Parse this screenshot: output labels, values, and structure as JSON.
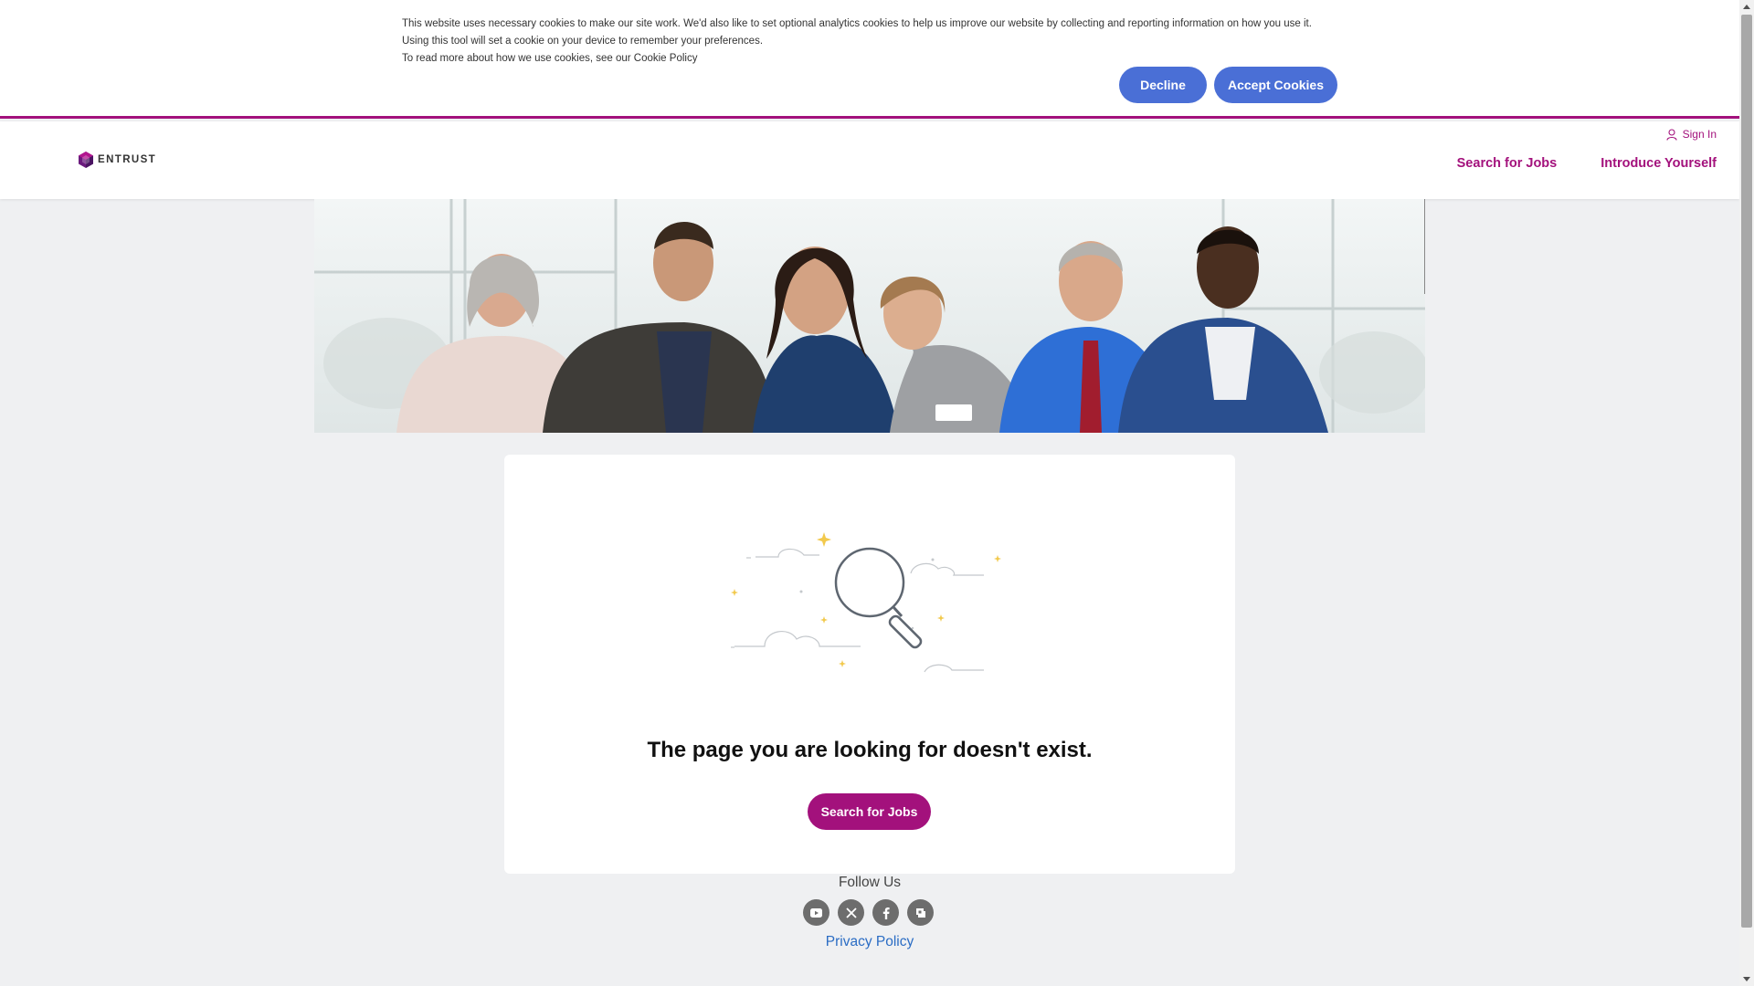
{
  "cookie_banner": {
    "line1": "This website uses necessary cookies to make our site work. We'd also like to set optional analytics cookies to help us improve our website by collecting and reporting information on how you use it. Using this tool will set a cookie on your device to remember your preferences.",
    "line2_prefix": "To read more about how we use cookies, see our ",
    "policy_link": "Cookie Policy",
    "decline_label": "Decline",
    "accept_label": "Accept Cookies",
    "button_color": "#4a6fd6"
  },
  "header": {
    "logo_text": "ENTRUST",
    "sign_in": "Sign In",
    "nav": [
      "Search for Jobs",
      "Introduce Yourself"
    ],
    "accent_color": "#a3117c"
  },
  "main": {
    "title": "The page you are looking for doesn't exist.",
    "button_label": "Search for Jobs"
  },
  "footer": {
    "follow_label": "Follow Us",
    "socials": [
      "youtube-icon",
      "x-icon",
      "facebook-icon",
      "glassdoor-icon"
    ],
    "privacy_label": "Privacy Policy"
  }
}
